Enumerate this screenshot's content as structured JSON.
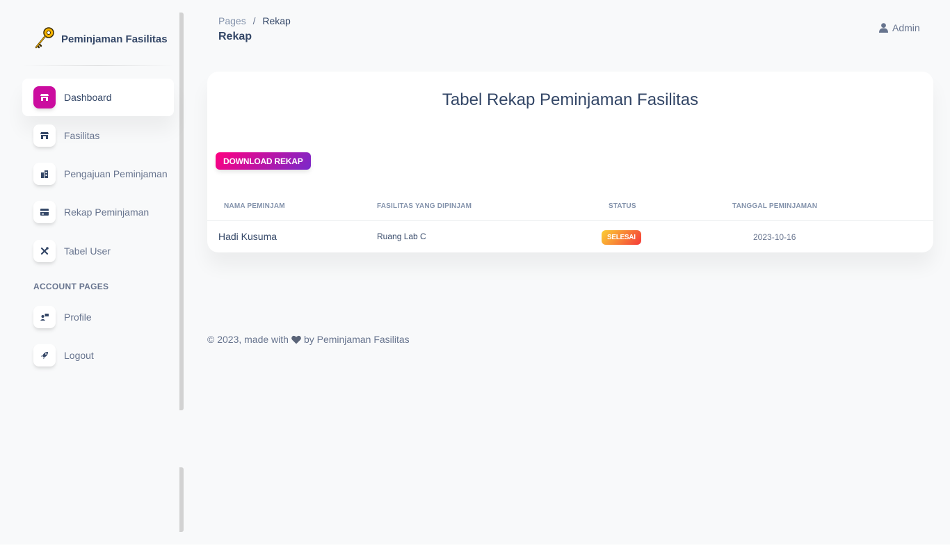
{
  "sidebar": {
    "brand": "Peminjaman Fasilitas",
    "items": [
      {
        "label": "Dashboard",
        "icon": "shop-icon",
        "active": true
      },
      {
        "label": "Fasilitas",
        "icon": "shop-icon"
      },
      {
        "label": "Pengajuan Peminjaman",
        "icon": "office-icon"
      },
      {
        "label": "Rekap Peminjaman",
        "icon": "credit-card-icon"
      },
      {
        "label": "Tabel User",
        "icon": "settings-tools-icon"
      }
    ],
    "section_title": "ACCOUNT PAGES",
    "account_items": [
      {
        "label": "Profile",
        "icon": "profile-icon"
      },
      {
        "label": "Logout",
        "icon": "rocket-icon"
      }
    ]
  },
  "header": {
    "breadcrumb_root": "Pages",
    "breadcrumb_separator": "/",
    "breadcrumb_current": "Rekap",
    "title": "Rekap",
    "user": "Admin"
  },
  "card": {
    "title": "Tabel Rekap Peminjaman Fasilitas",
    "download_label": "DOWNLOAD REKAP",
    "columns": [
      "NAMA PEMINJAM",
      "FASILITAS YANG DIPINJAM",
      "STATUS",
      "TANGGAL PEMINJAMAN"
    ],
    "rows": [
      {
        "name": "Hadi Kusuma",
        "facility": "Ruang Lab C",
        "status": "SELESAI",
        "date": "2023-10-16"
      }
    ]
  },
  "footer": {
    "prefix": "© 2023, made with",
    "suffix": "by Peminjaman Fasilitas"
  },
  "colors": {
    "accent": "#cb0c9f",
    "text": "#344767",
    "muted": "#67748e"
  }
}
